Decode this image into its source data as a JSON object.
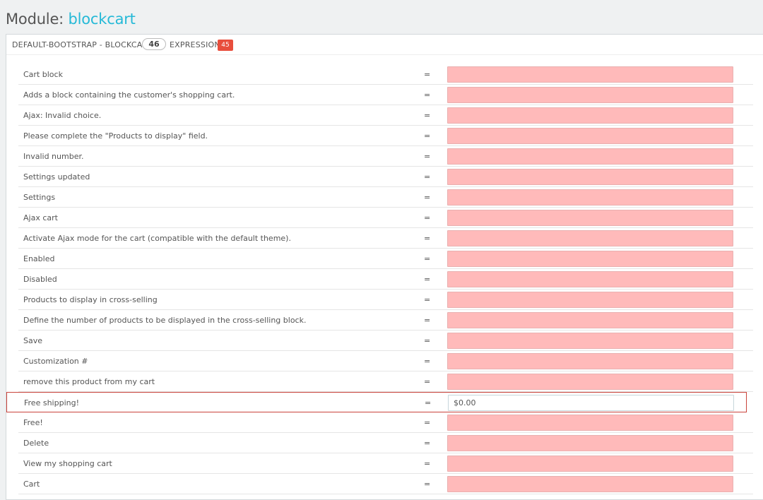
{
  "page": {
    "title_prefix": "Module: ",
    "module_name": "blockcart"
  },
  "panel": {
    "heading": "DEFAULT-BOOTSTRAP - BLOCKCART",
    "count": "46",
    "expressions_label": "EXPRESSIONS",
    "missing_count": "45"
  },
  "rows": [
    {
      "label": "Cart block",
      "eq": "=",
      "value": ""
    },
    {
      "label": "Adds a block containing the customer's shopping cart.",
      "eq": "=",
      "value": ""
    },
    {
      "label": "Ajax: Invalid choice.",
      "eq": "=",
      "value": ""
    },
    {
      "label": "Please complete the \"Products to display\" field.",
      "eq": "=",
      "value": ""
    },
    {
      "label": "Invalid number.",
      "eq": "=",
      "value": ""
    },
    {
      "label": "Settings updated",
      "eq": "=",
      "value": ""
    },
    {
      "label": "Settings",
      "eq": "=",
      "value": ""
    },
    {
      "label": "Ajax cart",
      "eq": "=",
      "value": ""
    },
    {
      "label": "Activate Ajax mode for the cart (compatible with the default theme).",
      "eq": "=",
      "value": ""
    },
    {
      "label": "Enabled",
      "eq": "=",
      "value": ""
    },
    {
      "label": "Disabled",
      "eq": "=",
      "value": ""
    },
    {
      "label": "Products to display in cross-selling",
      "eq": "=",
      "value": ""
    },
    {
      "label": "Define the number of products to be displayed in the cross-selling block.",
      "eq": "=",
      "value": ""
    },
    {
      "label": "Save",
      "eq": "=",
      "value": ""
    },
    {
      "label": "Customization #",
      "eq": "=",
      "value": ""
    },
    {
      "label": "remove this product from my cart",
      "eq": "=",
      "value": ""
    },
    {
      "label": "Free shipping!",
      "eq": "=",
      "value": "$0.00"
    },
    {
      "label": "Free!",
      "eq": "=",
      "value": ""
    },
    {
      "label": "Delete",
      "eq": "=",
      "value": ""
    },
    {
      "label": "View my shopping cart",
      "eq": "=",
      "value": ""
    },
    {
      "label": "Cart",
      "eq": "=",
      "value": ""
    }
  ],
  "colors": {
    "accent": "#25b9d7",
    "missing_field": "#ffbaba",
    "missing_badge": "#e84e3c",
    "selected_border": "#c9433b"
  }
}
